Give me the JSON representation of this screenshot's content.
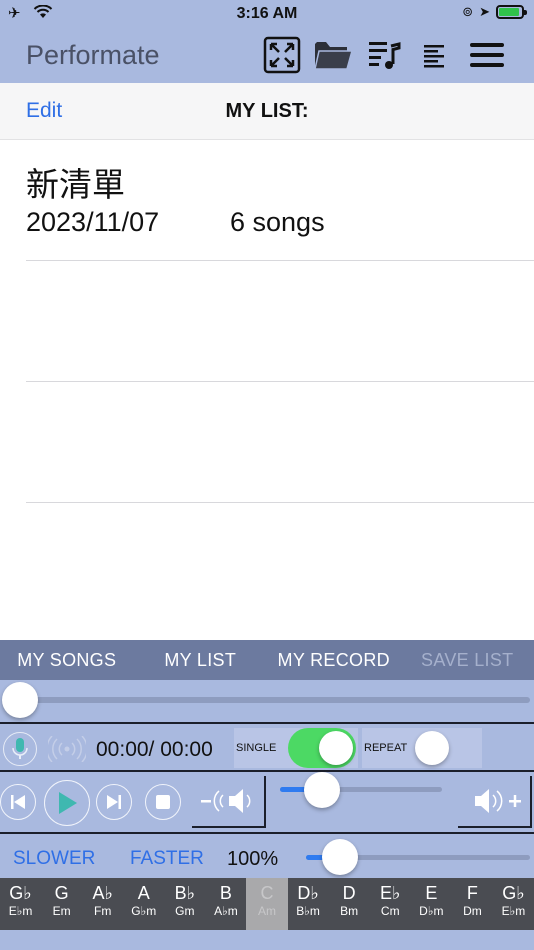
{
  "status": {
    "time": "3:16 AM"
  },
  "app": {
    "title": "Performate"
  },
  "nav": {
    "edit_label": "Edit",
    "title": "MY LIST:"
  },
  "lists": [
    {
      "name": "新清單",
      "date": "2023/11/07",
      "count": "6 songs"
    }
  ],
  "tabs": [
    {
      "label": "MY SONGS",
      "enabled": true
    },
    {
      "label": "MY LIST",
      "enabled": true
    },
    {
      "label": "MY RECORD",
      "enabled": true
    },
    {
      "label": "SAVE LIST",
      "enabled": false
    }
  ],
  "playback": {
    "position_fraction": 0,
    "time_text": "00:00/ 00:00",
    "single_label": "SINGLE",
    "single_on": true,
    "repeat_label": "REPEAT",
    "repeat_on": false,
    "volume_fraction": 0.26
  },
  "speed": {
    "slower_label": "SLOWER",
    "faster_label": "FASTER",
    "percent": "100%",
    "slider_fraction": 0.15
  },
  "keys": [
    {
      "major": "G♭",
      "minor": "E♭m"
    },
    {
      "major": "G",
      "minor": "Em"
    },
    {
      "major": "A♭",
      "minor": "Fm"
    },
    {
      "major": "A",
      "minor": "G♭m"
    },
    {
      "major": "B♭",
      "minor": "Gm"
    },
    {
      "major": "B",
      "minor": "A♭m"
    },
    {
      "major": "C",
      "minor": "Am",
      "active": true
    },
    {
      "major": "D♭",
      "minor": "B♭m"
    },
    {
      "major": "D",
      "minor": "Bm"
    },
    {
      "major": "E♭",
      "minor": "Cm"
    },
    {
      "major": "E",
      "minor": "D♭m"
    },
    {
      "major": "F",
      "minor": "Dm"
    },
    {
      "major": "G♭",
      "minor": "E♭m"
    }
  ],
  "colors": {
    "accent": "#2f6fe6",
    "toggle_on": "#4cd964",
    "panel": "#a9b9df",
    "tabbar": "#6c7a9f"
  }
}
